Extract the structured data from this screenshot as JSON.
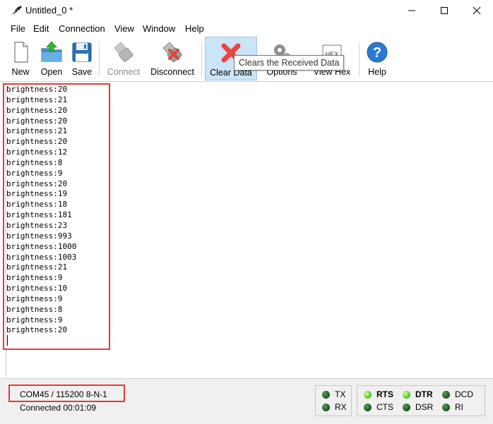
{
  "window": {
    "title": "Untitled_0 *"
  },
  "menu": [
    "File",
    "Edit",
    "Connection",
    "View",
    "Window",
    "Help"
  ],
  "toolbar": {
    "new": "New",
    "open": "Open",
    "save": "Save",
    "connect": "Connect",
    "disconnect": "Disconnect",
    "clear_data": "Clear Data",
    "options": "Options",
    "view_hex": "View Hex",
    "help": "Help",
    "hex_glyph": "HEX"
  },
  "tooltip": "Clears the Received Data",
  "terminal": {
    "lines": [
      "brightness:20",
      "brightness:21",
      "brightness:20",
      "brightness:20",
      "brightness:21",
      "brightness:20",
      "brightness:12",
      "brightness:8",
      "brightness:9",
      "brightness:20",
      "brightness:19",
      "brightness:18",
      "brightness:181",
      "brightness:23",
      "brightness:993",
      "brightness:1000",
      "brightness:1003",
      "brightness:21",
      "brightness:9",
      "brightness:10",
      "brightness:9",
      "brightness:8",
      "brightness:9",
      "brightness:20"
    ]
  },
  "status": {
    "port": "COM45 / 115200 8-N-1",
    "connection": "Connected 00:01:09"
  },
  "signals": {
    "tx": "TX",
    "rx": "RX",
    "rts": "RTS",
    "cts": "CTS",
    "dtr": "DTR",
    "dsr": "DSR",
    "dcd": "DCD",
    "ri": "RI"
  },
  "colors": {
    "highlight": "#e53a3a",
    "led_on": "#4cc81c",
    "led_off": "#1e4f1e",
    "accent": "#1a73d9"
  }
}
